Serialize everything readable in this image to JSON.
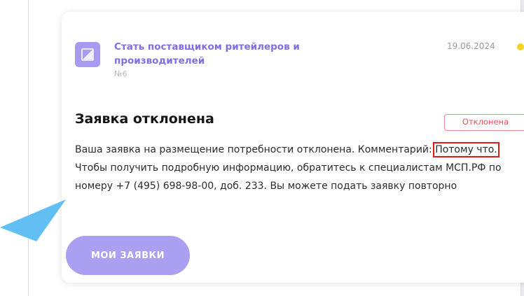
{
  "card": {
    "service_title": "Стать поставщиком ритейлеров и производителей",
    "service_number": "№6",
    "date": "19.06.2024",
    "heading": "Заявка отклонена",
    "status_badge": "Отклонена",
    "message_before": "Ваша заявка на размещение потребности отклонена. Комментарий: ",
    "message_highlight": "Потому что.",
    "message_after": " Чтобы получить подробную информацию, обратитесь к специалистам МСП.РФ по номеру +7 (495) 698-98-00, доб. 233. Вы можете подать заявку повторно",
    "button_label": "МОИ ЗАЯВКИ"
  },
  "icons": {
    "service": "image-placeholder-icon",
    "status": "status-dot-icon",
    "pointer": "pointer-arrow-icon"
  },
  "colors": {
    "accent": "#7e6fe4",
    "button": "#ab9ff2",
    "status_dot": "#f5d21f",
    "rejected": "#e5525d",
    "highlight_box": "#e01b1b",
    "pointer_arrow": "#62bff3"
  }
}
